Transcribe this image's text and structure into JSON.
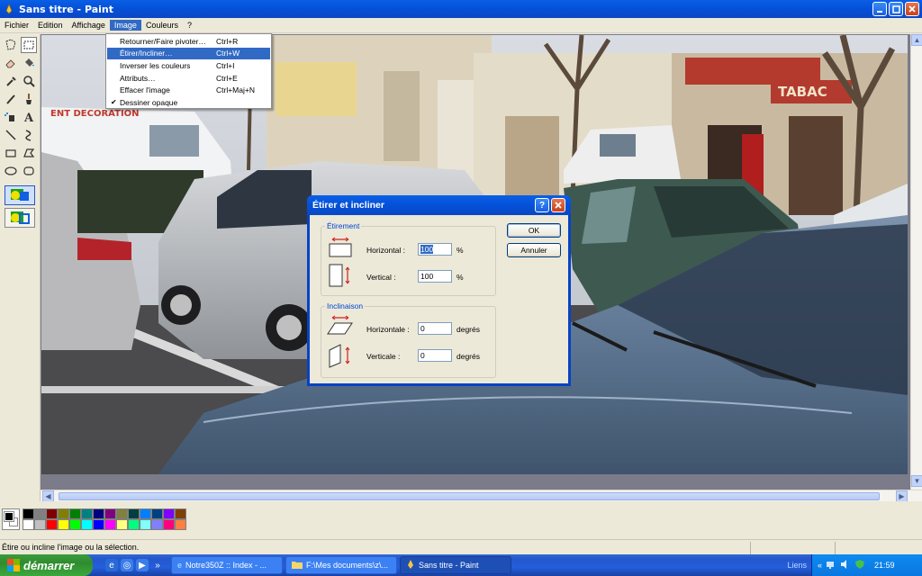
{
  "window": {
    "title": "Sans titre - Paint"
  },
  "menubar": [
    "Fichier",
    "Edition",
    "Affichage",
    "Image",
    "Couleurs",
    "?"
  ],
  "image_menu": {
    "items": [
      {
        "label": "Retourner/Faire pivoter…",
        "shortcut": "Ctrl+R"
      },
      {
        "label": "Étirer/Incliner…",
        "shortcut": "Ctrl+W"
      },
      {
        "label": "Inverser les couleurs",
        "shortcut": "Ctrl+I"
      },
      {
        "label": "Attributs…",
        "shortcut": "Ctrl+E"
      },
      {
        "label": "Effacer l'image",
        "shortcut": "Ctrl+Maj+N"
      },
      {
        "label": "Dessiner opaque",
        "shortcut": ""
      }
    ]
  },
  "dialog": {
    "title": "Étirer et incliner",
    "stretch_group": "Étirement",
    "horizontal_label": "Horizontal :",
    "horizontal_value": "100",
    "vertical_label": "Vertical :",
    "vertical_value": "100",
    "percent": "%",
    "skew_group": "Inclinaison",
    "skew_h_label": "Horizontale :",
    "skew_h_value": "0",
    "skew_v_label": "Verticale :",
    "skew_v_value": "0",
    "degrees": "degrés",
    "ok": "OK",
    "cancel": "Annuler"
  },
  "palette": {
    "colors": [
      "#000000",
      "#808080",
      "#800000",
      "#808000",
      "#008000",
      "#008080",
      "#000080",
      "#800080",
      "#808040",
      "#004040",
      "#0080ff",
      "#004080",
      "#8000ff",
      "#804000",
      "#ffffff",
      "#c0c0c0",
      "#ff0000",
      "#ffff00",
      "#00ff00",
      "#00ffff",
      "#0000ff",
      "#ff00ff",
      "#ffff80",
      "#00ff80",
      "#80ffff",
      "#8080ff",
      "#ff0080",
      "#ff8040"
    ]
  },
  "status": {
    "text": "Étire ou incline l'image ou la sélection."
  },
  "taskbar": {
    "start": "démarrer",
    "tasks": [
      "Notre350Z :: Index - ...",
      "F:\\Mes documents\\z\\...",
      "Sans titre - Paint"
    ],
    "links": "Liens",
    "clock": "21:59"
  },
  "photo_signs": {
    "tabac": "TABAC",
    "deco": "ENT DECORATION"
  }
}
